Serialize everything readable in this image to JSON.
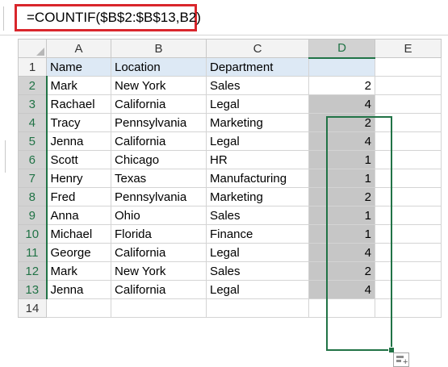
{
  "formula_bar": {
    "formula": "=COUNTIF($B$2:$B$13,B2)"
  },
  "column_headers": [
    "A",
    "B",
    "C",
    "D",
    "E"
  ],
  "rows": [
    {
      "row": "1",
      "a": "Name",
      "b": "Location",
      "c": "Department",
      "d": ""
    },
    {
      "row": "2",
      "a": "Mark",
      "b": "New York",
      "c": "Sales",
      "d": "2"
    },
    {
      "row": "3",
      "a": "Rachael",
      "b": "California",
      "c": "Legal",
      "d": "4"
    },
    {
      "row": "4",
      "a": "Tracy",
      "b": "Pennsylvania",
      "c": "Marketing",
      "d": "2"
    },
    {
      "row": "5",
      "a": "Jenna",
      "b": "California",
      "c": "Legal",
      "d": "4"
    },
    {
      "row": "6",
      "a": "Scott",
      "b": "Chicago",
      "c": "HR",
      "d": "1"
    },
    {
      "row": "7",
      "a": "Henry",
      "b": "Texas",
      "c": "Manufacturing",
      "d": "1"
    },
    {
      "row": "8",
      "a": "Fred",
      "b": "Pennsylvania",
      "c": "Marketing",
      "d": "2"
    },
    {
      "row": "9",
      "a": "Anna",
      "b": "Ohio",
      "c": "Sales",
      "d": "1"
    },
    {
      "row": "10",
      "a": "Michael",
      "b": "Florida",
      "c": "Finance",
      "d": "1"
    },
    {
      "row": "11",
      "a": "George",
      "b": "California",
      "c": "Legal",
      "d": "4"
    },
    {
      "row": "12",
      "a": "Mark",
      "b": "New York",
      "c": "Sales",
      "d": "2"
    },
    {
      "row": "13",
      "a": "Jenna",
      "b": "California",
      "c": "Legal",
      "d": "4"
    },
    {
      "row": "14",
      "a": "",
      "b": "",
      "c": "",
      "d": ""
    }
  ],
  "colors": {
    "selection_border": "#217346",
    "formula_highlight": "#d9262c",
    "header_fill": "#dde9f5",
    "selected_fill": "#c6c6c6"
  },
  "icons": {
    "quick_analysis": "quick-analysis-icon",
    "fill_handle": "fill-handle"
  }
}
